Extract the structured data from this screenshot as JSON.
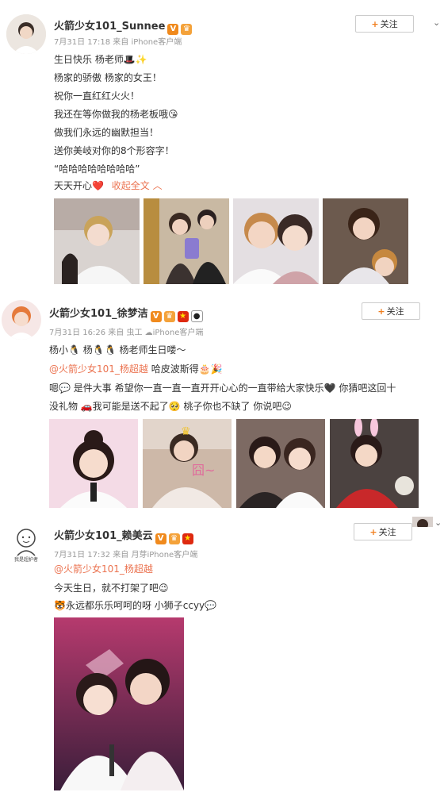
{
  "posts": [
    {
      "name": "火箭少女101_Sunnee",
      "meta": "7月31日 17:18 来自 iPhone客户端",
      "follow": "关注",
      "lines": [
        "生日快乐 杨老师🎩✨",
        "杨家的骄傲 杨家的女王！",
        "祝你一直红红火火！",
        "我还在等你做我的杨老板哦😘",
        "做我们永远的幽默担当！",
        "送你美岐对你的8个形容字！",
        "“哈哈哈哈哈哈哈哈”"
      ],
      "last_line": "天天开心❤️",
      "collapse": "收起全文 ︿"
    },
    {
      "name": "火箭少女101_徐梦洁",
      "meta": "7月31日 16:26 来自 虫工 ☁iPhone客户端",
      "follow": "关注",
      "line1": "杨小🐧 杨🐧🐧 杨老师生日喽～",
      "mention": "@火箭少女101_杨超越",
      "mention_tail": " 哈皮波斯得🎂🎉",
      "line3": "嗯💬 是件大事 希望你一直一直一直开开心心的一直带给大家快乐🖤 你猜吧这回十",
      "line4": "没礼物 🚗我可能是送不起了🥺 桃子你也不缺了 你说吧😉"
    },
    {
      "name": "火箭少女101_赖美云",
      "meta": "7月31日 17:32 来自 月芽iPhone客户端",
      "follow": "关注",
      "mention": "@火箭少女101_杨超越",
      "line2": "今天生日，就不打架了吧😉",
      "line3": "🐯永远都乐乐呵呵的呀 小狮子ccyy💬",
      "avatar_caption": "我是超护者"
    }
  ],
  "colors": {
    "link": "#eb7350",
    "follow_plus": "#f07e1d",
    "meta": "#999999"
  }
}
